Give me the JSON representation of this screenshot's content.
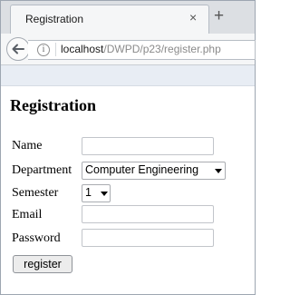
{
  "browser": {
    "tab_title": "Registration",
    "close_glyph": "×",
    "new_tab_glyph": "+",
    "info_glyph": "i",
    "url_host": "localhost",
    "url_path": "/DWPD/p23/register.php"
  },
  "page": {
    "title": "Registration",
    "form": {
      "name_label": "Name",
      "name_value": "",
      "department_label": "Department",
      "department_value": "Computer Engineering",
      "semester_label": "Semester",
      "semester_value": "1",
      "email_label": "Email",
      "email_value": "",
      "password_label": "Password",
      "password_value": "",
      "submit_label": "register"
    }
  },
  "icons": {
    "back": "back-arrow-icon",
    "info": "info-icon",
    "close": "close-icon",
    "new_tab": "plus-icon",
    "dropdown": "chevron-down-icon"
  }
}
